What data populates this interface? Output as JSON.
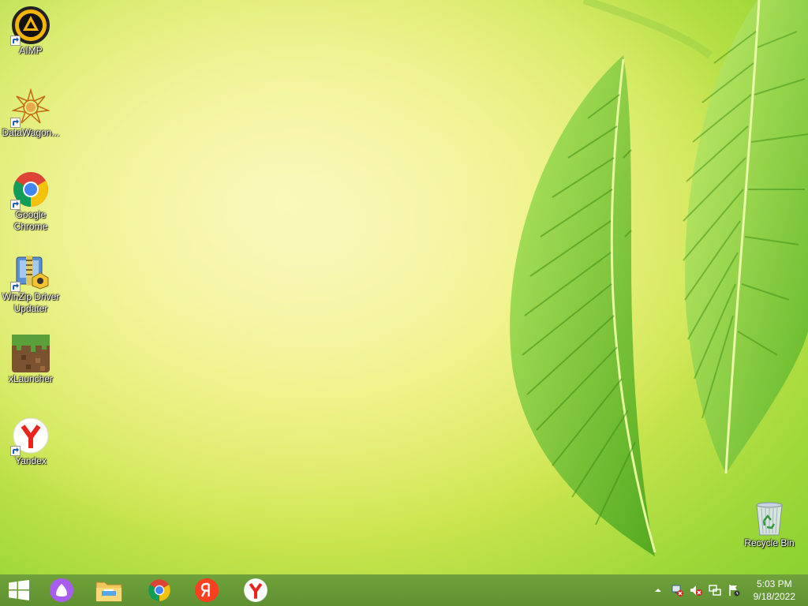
{
  "desktop": {
    "icons": [
      {
        "label": "AIMP",
        "icon": "aimp-icon"
      },
      {
        "label": "DataWagon...",
        "icon": "datawagon-icon"
      },
      {
        "label": "Google Chrome",
        "icon": "chrome-icon"
      },
      {
        "label": "WinZip Driver Updater",
        "icon": "winzip-driver-updater-icon"
      },
      {
        "label": "xLauncher",
        "icon": "xlauncher-icon"
      },
      {
        "label": "Yandex",
        "icon": "yandex-browser-icon"
      }
    ],
    "recycle_bin": {
      "label": "Recycle Bin",
      "icon": "recycle-bin-icon"
    }
  },
  "taskbar": {
    "buttons": [
      "start-icon",
      "alice-icon",
      "file-explorer-icon",
      "chrome-icon",
      "yandex-icon",
      "yandex-browser-icon"
    ],
    "tray": [
      "show-hidden-icons-arrow",
      "network-error-icon",
      "volume-muted-icon",
      "network-icon",
      "action-center-icon"
    ],
    "clock": {
      "time": "5:03 PM",
      "date": "9/18/2022"
    }
  },
  "colors": {
    "taskbar": "#6a9c37",
    "wallpaper": "#d6ea55"
  }
}
